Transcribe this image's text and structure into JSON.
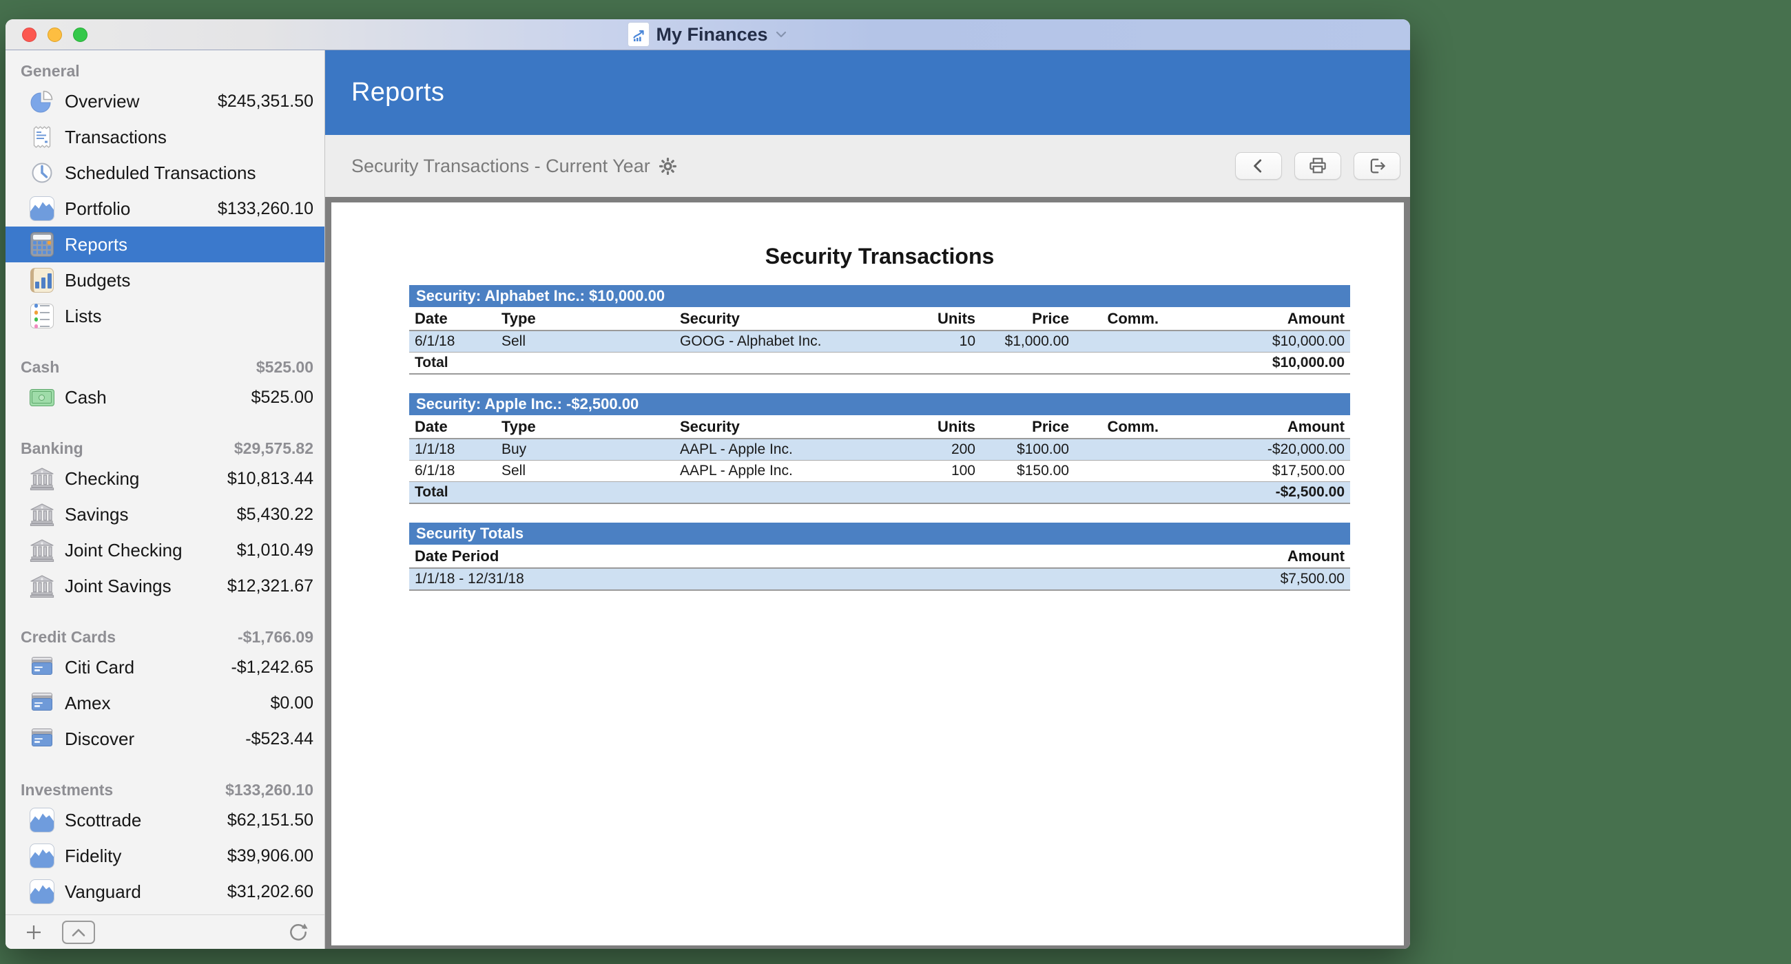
{
  "window": {
    "title": "My Finances",
    "traffic_lights": [
      "close",
      "minimize",
      "zoom"
    ],
    "title_icon": "document-chart-icon",
    "title_chevron": "chevron-down-icon"
  },
  "colors": {
    "desktop_green": "#47714E",
    "header_blue": "#3B77C4",
    "section_bar_blue": "#4B80C3",
    "row_stripe_blue": "#CEE0F2",
    "selected_item_blue": "#3B79CC"
  },
  "sidebar": {
    "sections": [
      {
        "label": "General",
        "amount": "",
        "items": [
          {
            "icon": "pie-chart-icon",
            "label": "Overview",
            "amount": "$245,351.50"
          },
          {
            "icon": "receipt-icon",
            "label": "Transactions",
            "amount": ""
          },
          {
            "icon": "clock-icon",
            "label": "Scheduled Transactions",
            "amount": ""
          },
          {
            "icon": "area-chart-icon",
            "label": "Portfolio",
            "amount": "$133,260.10"
          },
          {
            "icon": "calculator-icon",
            "label": "Reports",
            "amount": "",
            "selected": true
          },
          {
            "icon": "bar-chart-icon",
            "label": "Budgets",
            "amount": ""
          },
          {
            "icon": "list-icon",
            "label": "Lists",
            "amount": ""
          }
        ]
      },
      {
        "label": "Cash",
        "amount": "$525.00",
        "items": [
          {
            "icon": "cash-icon",
            "label": "Cash",
            "amount": "$525.00"
          }
        ]
      },
      {
        "label": "Banking",
        "amount": "$29,575.82",
        "items": [
          {
            "icon": "bank-icon",
            "label": "Checking",
            "amount": "$10,813.44"
          },
          {
            "icon": "bank-icon",
            "label": "Savings",
            "amount": "$5,430.22"
          },
          {
            "icon": "bank-icon",
            "label": "Joint Checking",
            "amount": "$1,010.49"
          },
          {
            "icon": "bank-icon",
            "label": "Joint Savings",
            "amount": "$12,321.67"
          }
        ]
      },
      {
        "label": "Credit Cards",
        "amount": "-$1,766.09",
        "items": [
          {
            "icon": "credit-card-icon",
            "label": "Citi Card",
            "amount": "-$1,242.65"
          },
          {
            "icon": "credit-card-icon",
            "label": "Amex",
            "amount": "$0.00"
          },
          {
            "icon": "credit-card-icon",
            "label": "Discover",
            "amount": "-$523.44"
          }
        ]
      },
      {
        "label": "Investments",
        "amount": "$133,260.10",
        "items": [
          {
            "icon": "area-chart-icon",
            "label": "Scottrade",
            "amount": "$62,151.50"
          },
          {
            "icon": "area-chart-icon",
            "label": "Fidelity",
            "amount": "$39,906.00"
          },
          {
            "icon": "area-chart-icon",
            "label": "Vanguard",
            "amount": "$31,202.60"
          }
        ]
      }
    ],
    "bottom_toolbar": {
      "icons": [
        "plus-icon",
        "panel-collapse-icon",
        "refresh-icon"
      ]
    }
  },
  "header": {
    "title": "Reports"
  },
  "toolbar": {
    "report_name": "Security Transactions - Current Year",
    "gear_icon": "gear-icon",
    "buttons": [
      {
        "name": "back",
        "icon": "back-chevron-icon"
      },
      {
        "name": "print",
        "icon": "printer-icon"
      },
      {
        "name": "export",
        "icon": "export-icon"
      }
    ]
  },
  "report": {
    "title": "Security Transactions",
    "tables": [
      {
        "header": "Security: Alphabet Inc.: $10,000.00",
        "columns": [
          "Date",
          "Type",
          "Security",
          "Units",
          "Price",
          "Comm.",
          "Amount"
        ],
        "rows": [
          [
            "6/1/18",
            "Sell",
            "GOOG - Alphabet Inc.",
            "10",
            "$1,000.00",
            "",
            "$10,000.00"
          ]
        ],
        "total_label": "Total",
        "total_amount": "$10,000.00"
      },
      {
        "header": "Security: Apple Inc.: -$2,500.00",
        "columns": [
          "Date",
          "Type",
          "Security",
          "Units",
          "Price",
          "Comm.",
          "Amount"
        ],
        "rows": [
          [
            "1/1/18",
            "Buy",
            "AAPL - Apple Inc.",
            "200",
            "$100.00",
            "",
            "-$20,000.00"
          ],
          [
            "6/1/18",
            "Sell",
            "AAPL - Apple Inc.",
            "100",
            "$150.00",
            "",
            "$17,500.00"
          ]
        ],
        "total_label": "Total",
        "total_amount": "-$2,500.00"
      },
      {
        "header": "Security Totals",
        "columns": [
          "Date Period",
          "Amount"
        ],
        "rows": [
          [
            "1/1/18 - 12/31/18",
            "$7,500.00"
          ]
        ]
      }
    ]
  }
}
